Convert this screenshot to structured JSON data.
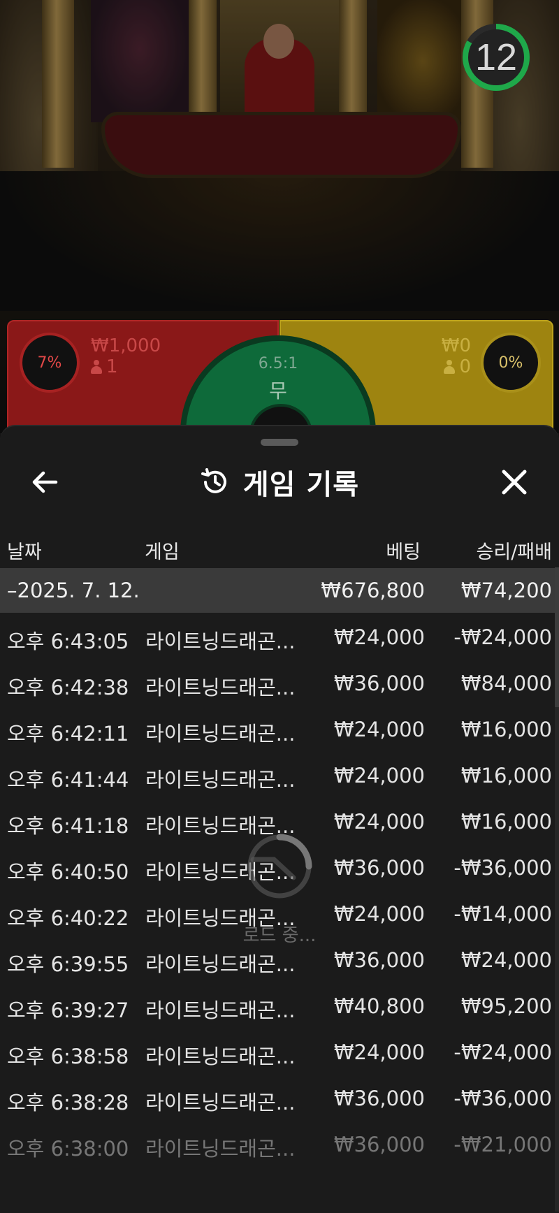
{
  "timer": {
    "seconds": "12",
    "ring_color": "#1fa84a"
  },
  "bets": {
    "dragon": {
      "percent": "7%",
      "amount": "₩1,000",
      "players": "1",
      "color": "#8a1818"
    },
    "tiger": {
      "percent": "0%",
      "amount": "₩0",
      "players": "0",
      "color": "#9e8410"
    },
    "tie": {
      "odds": "6.5:1",
      "label": "무",
      "color": "#0e6a3a"
    }
  },
  "sheet": {
    "title": "게임 기록",
    "columns": {
      "date": "날짜",
      "game": "게임",
      "bet": "베팅",
      "win_loss": "승리/패배"
    },
    "summary": {
      "date": "–2025. 7. 12.",
      "bet": "₩676,800",
      "win_loss": "₩74,200"
    },
    "rows": [
      {
        "time": "오후 6:43:05",
        "game": "라이트닝드래곤...",
        "bet": "₩24,000",
        "win_loss": "-₩24,000"
      },
      {
        "time": "오후 6:42:38",
        "game": "라이트닝드래곤...",
        "bet": "₩36,000",
        "win_loss": "₩84,000"
      },
      {
        "time": "오후 6:42:11",
        "game": "라이트닝드래곤...",
        "bet": "₩24,000",
        "win_loss": "₩16,000"
      },
      {
        "time": "오후 6:41:44",
        "game": "라이트닝드래곤...",
        "bet": "₩24,000",
        "win_loss": "₩16,000"
      },
      {
        "time": "오후 6:41:18",
        "game": "라이트닝드래곤...",
        "bet": "₩24,000",
        "win_loss": "₩16,000"
      },
      {
        "time": "오후 6:40:50",
        "game": "라이트닝드래곤...",
        "bet": "₩36,000",
        "win_loss": "-₩36,000"
      },
      {
        "time": "오후 6:40:22",
        "game": "라이트닝드래곤...",
        "bet": "₩24,000",
        "win_loss": "-₩14,000"
      },
      {
        "time": "오후 6:39:55",
        "game": "라이트닝드래곤...",
        "bet": "₩36,000",
        "win_loss": "₩24,000"
      },
      {
        "time": "오후 6:39:27",
        "game": "라이트닝드래곤...",
        "bet": "₩40,800",
        "win_loss": "₩95,200"
      },
      {
        "time": "오후 6:38:58",
        "game": "라이트닝드래곤...",
        "bet": "₩24,000",
        "win_loss": "-₩24,000"
      },
      {
        "time": "오후 6:38:28",
        "game": "라이트닝드래곤...",
        "bet": "₩36,000",
        "win_loss": "-₩36,000"
      },
      {
        "time": "오후 6:38:00",
        "game": "라이트닝드래곤...",
        "bet": "₩36,000",
        "win_loss": "-₩21,000"
      }
    ],
    "loading_text": "로드 중..."
  },
  "icons": {
    "back": "arrow-left-icon",
    "history": "history-clock-icon",
    "close": "close-icon",
    "spinner": "loading-spinner-icon"
  }
}
